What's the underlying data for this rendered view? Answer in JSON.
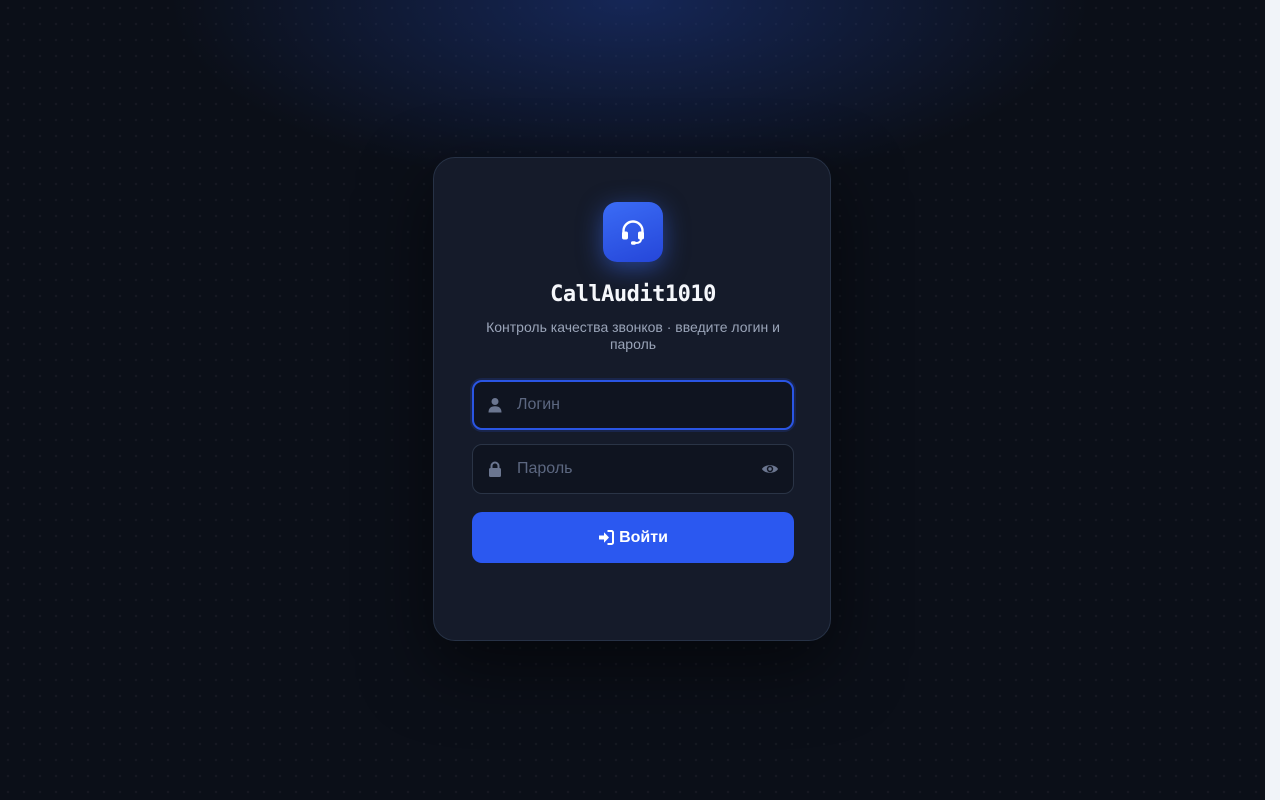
{
  "app": {
    "title": "CallAudit1010",
    "subtitle": "Контроль качества звонков · введите логин и пароль",
    "logo_icon": "headset-icon"
  },
  "login_field": {
    "value": "",
    "placeholder": "Логин",
    "icon": "user-icon"
  },
  "password_field": {
    "value": "",
    "placeholder": "Пароль",
    "icon": "lock-icon",
    "toggle_icon": "eye-icon"
  },
  "submit": {
    "label": "Войти",
    "icon": "sign-in-icon"
  },
  "colors": {
    "background": "#0b0f18",
    "card": "#151b2a",
    "accent": "#2b58f0",
    "focus_border": "#2a55e3",
    "text_primary": "#f5f7fb",
    "text_secondary": "#9aa4b8",
    "placeholder": "#5c6780"
  }
}
